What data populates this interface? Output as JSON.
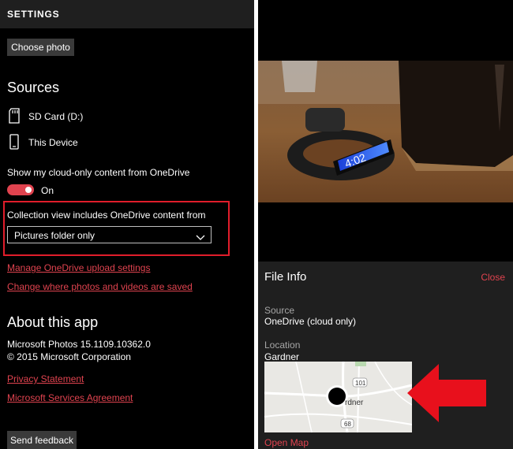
{
  "settings": {
    "header_title": "SETTINGS",
    "choose_photo_label": "Choose photo",
    "sources_title": "Sources",
    "sources": [
      {
        "label": "SD Card (D:)",
        "icon": "sd-card-icon"
      },
      {
        "label": "This Device",
        "icon": "phone-icon"
      }
    ],
    "cloud_only_label": "Show my cloud-only content from OneDrive",
    "toggle_state_label": "On",
    "collection_label": "Collection view includes OneDrive content from",
    "collection_value": "Pictures folder only",
    "manage_link": "Manage OneDrive upload settings",
    "change_link": "Change where photos and videos are saved",
    "about_title": "About this app",
    "version": "Microsoft Photos 15.1109.10362.0",
    "copyright": "© 2015 Microsoft Corporation",
    "privacy_link": "Privacy Statement",
    "services_link": "Microsoft Services Agreement",
    "send_feedback_label": "Send feedback"
  },
  "file_info": {
    "title": "File Info",
    "close_label": "Close",
    "source_label": "Source",
    "source_value": "OneDrive (cloud only)",
    "location_label": "Location",
    "location_value": "Gardner",
    "map_road_labels": [
      "101",
      "68"
    ],
    "map_place_label": "rdner",
    "open_map_label": "Open Map"
  },
  "colors": {
    "accent": "#e0434f",
    "highlight_box": "#e11d2b",
    "arrow": "#e8101c"
  }
}
